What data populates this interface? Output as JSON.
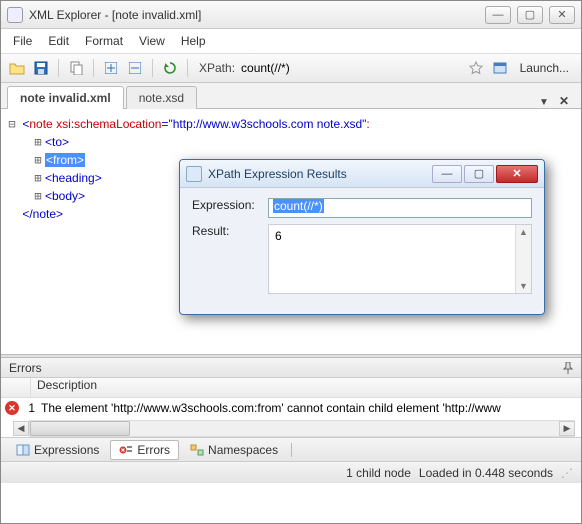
{
  "window": {
    "title": "XML Explorer - [note invalid.xml]"
  },
  "menubar": [
    "File",
    "Edit",
    "Format",
    "View",
    "Help"
  ],
  "toolbar": {
    "xpath_label": "XPath:",
    "xpath_value": "count(//*)",
    "launch_label": "Launch..."
  },
  "tabs": {
    "items": [
      {
        "label": "note invalid.xml",
        "active": true
      },
      {
        "label": "note.xsd",
        "active": false
      }
    ]
  },
  "xml": {
    "root_open": "<note",
    "root_attr_name": "xsi:schemaLocation",
    "root_attr_value": "\"http://www.w3schools.com note.xsd\"",
    "children": [
      {
        "label": "<to>",
        "selected": false
      },
      {
        "label": "<from>",
        "selected": true
      },
      {
        "label": "<heading>",
        "selected": false
      },
      {
        "label": "<body>",
        "selected": false
      }
    ],
    "root_close": "</note>"
  },
  "errors": {
    "panel_title": "Errors",
    "col_description": "Description",
    "rows": [
      {
        "num": "1",
        "text": "The element 'http://www.w3schools.com:from' cannot contain child element 'http://www"
      }
    ]
  },
  "bottom_tabs": [
    {
      "label": "Expressions",
      "active": false
    },
    {
      "label": "Errors",
      "active": true
    },
    {
      "label": "Namespaces",
      "active": false
    }
  ],
  "status": {
    "nodes": "1 child node",
    "loaded": "Loaded in 0.448 seconds"
  },
  "modal": {
    "title": "XPath Expression Results",
    "expression_label": "Expression:",
    "expression_value": "count(//*)",
    "result_label": "Result:",
    "result_value": "6"
  }
}
